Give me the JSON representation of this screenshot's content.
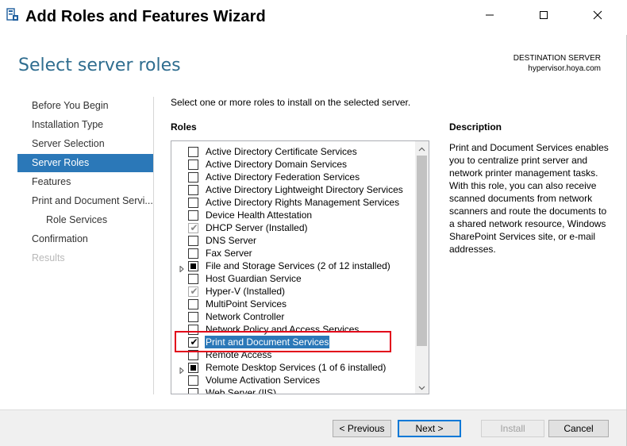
{
  "window": {
    "title": "Add Roles and Features Wizard",
    "app_icon": "server-manager-icon",
    "controls": [
      "minimize-icon",
      "maximize-icon",
      "close-icon"
    ]
  },
  "header": {
    "page_title": "Select server roles",
    "destination_label": "DESTINATION SERVER",
    "destination_server": "hypervisor.hoya.com"
  },
  "nav": {
    "items": [
      {
        "label": "Before You Begin",
        "state": "normal"
      },
      {
        "label": "Installation Type",
        "state": "normal"
      },
      {
        "label": "Server Selection",
        "state": "normal"
      },
      {
        "label": "Server Roles",
        "state": "active"
      },
      {
        "label": "Features",
        "state": "normal"
      },
      {
        "label": "Print and Document Servi...",
        "state": "normal"
      },
      {
        "label": "Role Services",
        "state": "normal",
        "indent": true
      },
      {
        "label": "Confirmation",
        "state": "normal"
      },
      {
        "label": "Results",
        "state": "disabled"
      }
    ]
  },
  "main": {
    "instruction": "Select one or more roles to install on the selected server.",
    "roles_heading": "Roles",
    "roles": [
      {
        "label": "Active Directory Certificate Services",
        "checked": "none"
      },
      {
        "label": "Active Directory Domain Services",
        "checked": "none"
      },
      {
        "label": "Active Directory Federation Services",
        "checked": "none"
      },
      {
        "label": "Active Directory Lightweight Directory Services",
        "checked": "none"
      },
      {
        "label": "Active Directory Rights Management Services",
        "checked": "none"
      },
      {
        "label": "Device Health Attestation",
        "checked": "none"
      },
      {
        "label": "DHCP Server (Installed)",
        "checked": "installed"
      },
      {
        "label": "DNS Server",
        "checked": "none"
      },
      {
        "label": "Fax Server",
        "checked": "none"
      },
      {
        "label": "File and Storage Services (2 of 12 installed)",
        "checked": "partial",
        "expandable": true
      },
      {
        "label": "Host Guardian Service",
        "checked": "none"
      },
      {
        "label": "Hyper-V (Installed)",
        "checked": "installed"
      },
      {
        "label": "MultiPoint Services",
        "checked": "none"
      },
      {
        "label": "Network Controller",
        "checked": "none"
      },
      {
        "label": "Network Policy and Access Services",
        "checked": "none"
      },
      {
        "label": "Print and Document Services",
        "checked": "checked",
        "selected": true
      },
      {
        "label": "Remote Access",
        "checked": "none"
      },
      {
        "label": "Remote Desktop Services (1 of 6 installed)",
        "checked": "partial",
        "expandable": true
      },
      {
        "label": "Volume Activation Services",
        "checked": "none"
      },
      {
        "label": "Web Server (IIS)",
        "checked": "none"
      }
    ]
  },
  "description": {
    "heading": "Description",
    "text": "Print and Document Services enables you to centralize print server and network printer management tasks. With this role, you can also receive scanned documents from network scanners and route the documents to a shared network resource, Windows SharePoint Services site, or e-mail addresses."
  },
  "footer": {
    "previous_label": "< Previous",
    "next_label": "Next >",
    "install_label": "Install",
    "cancel_label": "Cancel"
  },
  "colors": {
    "accent": "#2b78b8",
    "heading": "#2f6d8f",
    "highlight_box": "#e2001a"
  }
}
